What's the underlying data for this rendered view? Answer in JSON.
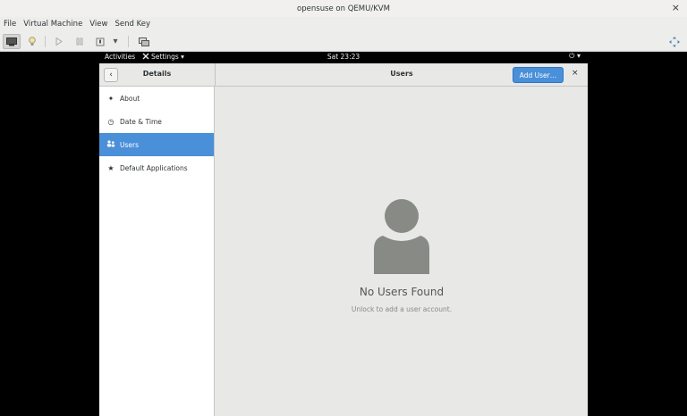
{
  "window": {
    "title": "opensuse on QEMU/KVM",
    "close": "×"
  },
  "menubar": {
    "items": [
      "File",
      "Virtual Machine",
      "View",
      "Send Key"
    ]
  },
  "toolbar": {
    "dropdown": "▾"
  },
  "gnome": {
    "activities": "Activities",
    "settings": "Settings ▾",
    "clock": "Sat 23:23",
    "power": "⏻ ▾"
  },
  "header": {
    "back": "‹",
    "side_title": "Details",
    "main_title": "Users",
    "add_user": "Add User…",
    "close": "×"
  },
  "sidebar": {
    "items": [
      {
        "label": "About",
        "icon": "✦"
      },
      {
        "label": "Date & Time",
        "icon": "◷"
      },
      {
        "label": "Users",
        "icon": "👥"
      },
      {
        "label": "Default Applications",
        "icon": "★"
      }
    ]
  },
  "empty": {
    "title": "No Users Found",
    "subtitle": "Unlock to add a user account."
  },
  "colors": {
    "accent": "#4a90d9",
    "avatar": "#888a85"
  }
}
